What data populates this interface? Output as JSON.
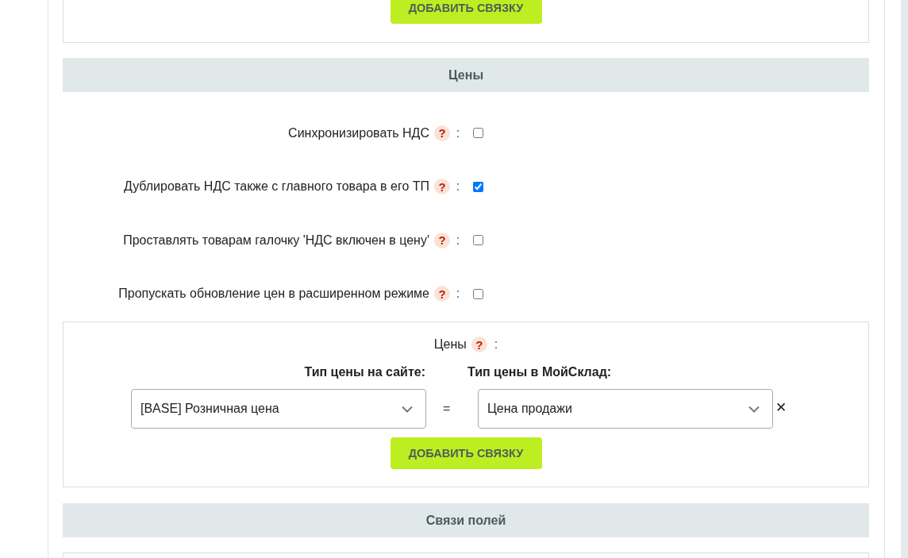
{
  "top_panel": {
    "add_button": "ДОБАВИТЬ СВЯЗКУ"
  },
  "prices": {
    "title": "Цены",
    "settings": [
      {
        "label": "Синхронизировать НДС",
        "help": "?",
        "colon": ":",
        "checked": false
      },
      {
        "label": "Дублировать НДС также с главного товара в его ТП",
        "help": "?",
        "colon": ":",
        "checked": true
      },
      {
        "label": "Проставлять товарам галочку 'НДС включен в цену'",
        "help": "?",
        "colon": ":",
        "checked": false
      },
      {
        "label": "Пропускать обновление цен в расширенном режиме",
        "help": "?",
        "colon": ":",
        "checked": false
      }
    ],
    "mapping": {
      "label": "Цены",
      "help": "?",
      "colon": ":",
      "columns": [
        "Тип цены на сайте:",
        "Тип цены в МойСклад:"
      ],
      "rows": [
        {
          "site_value": "[BASE] Розничная цена",
          "equals": "=",
          "moysklad_value": "Цена продажи",
          "remove": "✕"
        }
      ],
      "add_button": "ДОБАВИТЬ СВЯЗКУ"
    }
  },
  "field_links": {
    "title": "Связи полей"
  }
}
